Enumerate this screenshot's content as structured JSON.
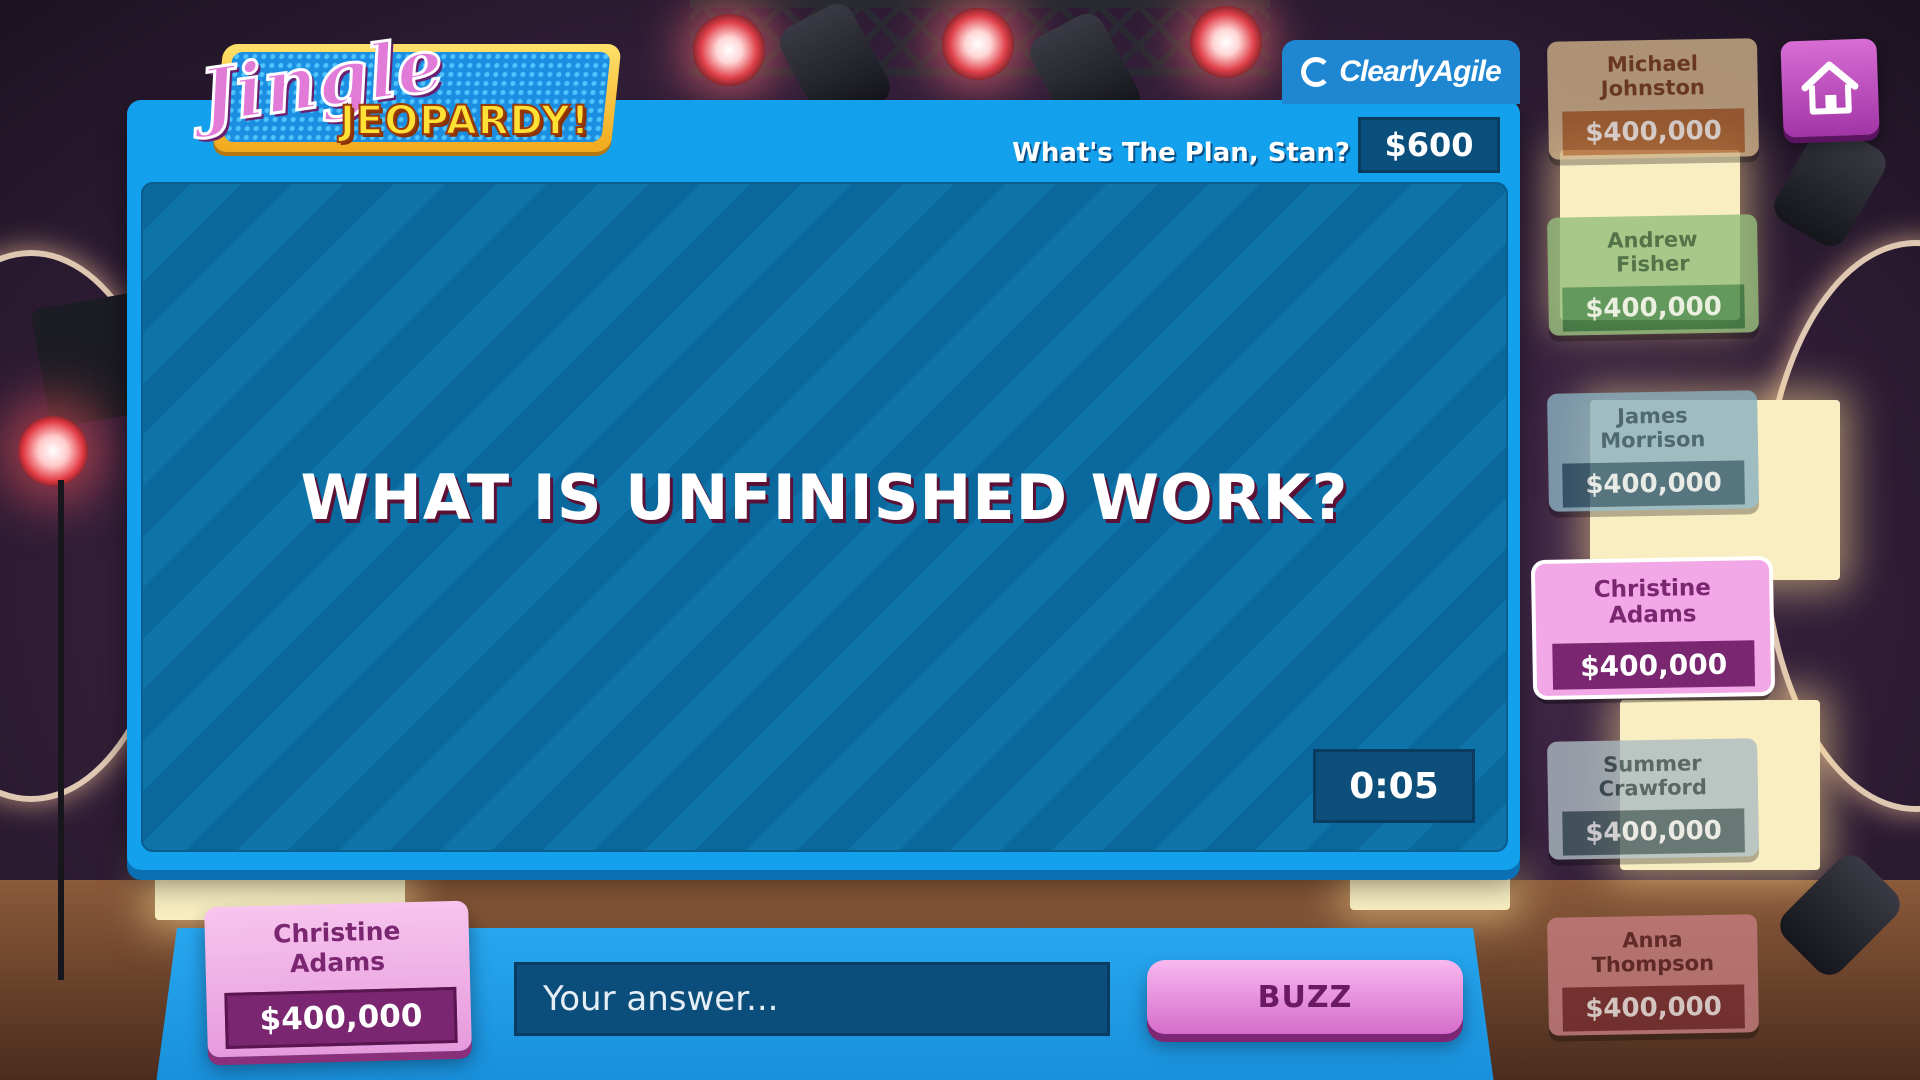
{
  "game": {
    "logo_script": "Jingle",
    "logo_block": "JEOPARDY!"
  },
  "brand": {
    "name": "ClearlyAgile",
    "icon": "clearlyagile-logo-icon"
  },
  "clue": {
    "category": "What's The Plan, Stan?",
    "value": "$600",
    "text": "WHAT IS UNFINISHED WORK?",
    "timer": "0:05"
  },
  "contestants": [
    {
      "name": "Michael\nJohnston",
      "score": "$400,000",
      "color": "#d8b07a",
      "bar": "#c0611c",
      "text_color": "#8a3c10",
      "active": false
    },
    {
      "name": "Andrew\nFisher",
      "score": "$400,000",
      "color": "#8cc46a",
      "bar": "#2f8a34",
      "text_color": "#1f5a22",
      "active": false
    },
    {
      "name": "James\nMorrison",
      "score": "$400,000",
      "color": "#7fb2c8",
      "bar": "#245a78",
      "text_color": "#1e4a62",
      "active": false
    },
    {
      "name": "Christine\nAdams",
      "score": "$400,000",
      "color": "#f2a8e6",
      "bar": "#7a2670",
      "text_color": "#7a2670",
      "active": true
    },
    {
      "name": "Summer\nCrawford",
      "score": "$400,000",
      "color": "#a8bcc4",
      "bar": "#3f5d66",
      "text_color": "#2e4a52",
      "active": false
    },
    {
      "name": "Anna\nThompson",
      "score": "$400,000",
      "color": "#d8787a",
      "bar": "#8a2a2c",
      "text_color": "#6a1e20",
      "active": false
    }
  ],
  "player": {
    "name": "Christine\nAdams",
    "score": "$400,000"
  },
  "answer": {
    "placeholder": "Your answer...",
    "value": ""
  },
  "buzz": {
    "label": "BUZZ"
  },
  "home": {
    "icon": "home-icon"
  }
}
